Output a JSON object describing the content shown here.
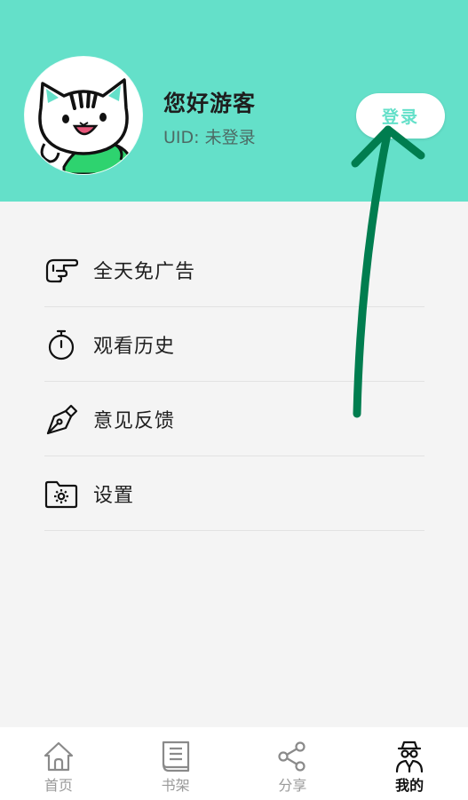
{
  "header": {
    "greeting": "您好游客",
    "uid": "UID: 未登录",
    "login_label": "登录",
    "bg_color": "#64e0c9",
    "accent_color": "#64e0c9"
  },
  "menu": {
    "items": [
      {
        "label": "全天免广告",
        "icon": "pointing-hand-icon"
      },
      {
        "label": "观看历史",
        "icon": "stopwatch-icon"
      },
      {
        "label": "意见反馈",
        "icon": "pen-nib-icon"
      },
      {
        "label": "设置",
        "icon": "folder-gear-icon"
      }
    ]
  },
  "bottom_nav": {
    "items": [
      {
        "label": "首页",
        "icon": "home-icon",
        "active": false
      },
      {
        "label": "书架",
        "icon": "book-icon",
        "active": false
      },
      {
        "label": "分享",
        "icon": "share-icon",
        "active": false
      },
      {
        "label": "我的",
        "icon": "spy-user-icon",
        "active": true
      }
    ]
  },
  "annotation": {
    "arrow_color": "#007d4f",
    "icon": "hand-drawn-arrow"
  }
}
